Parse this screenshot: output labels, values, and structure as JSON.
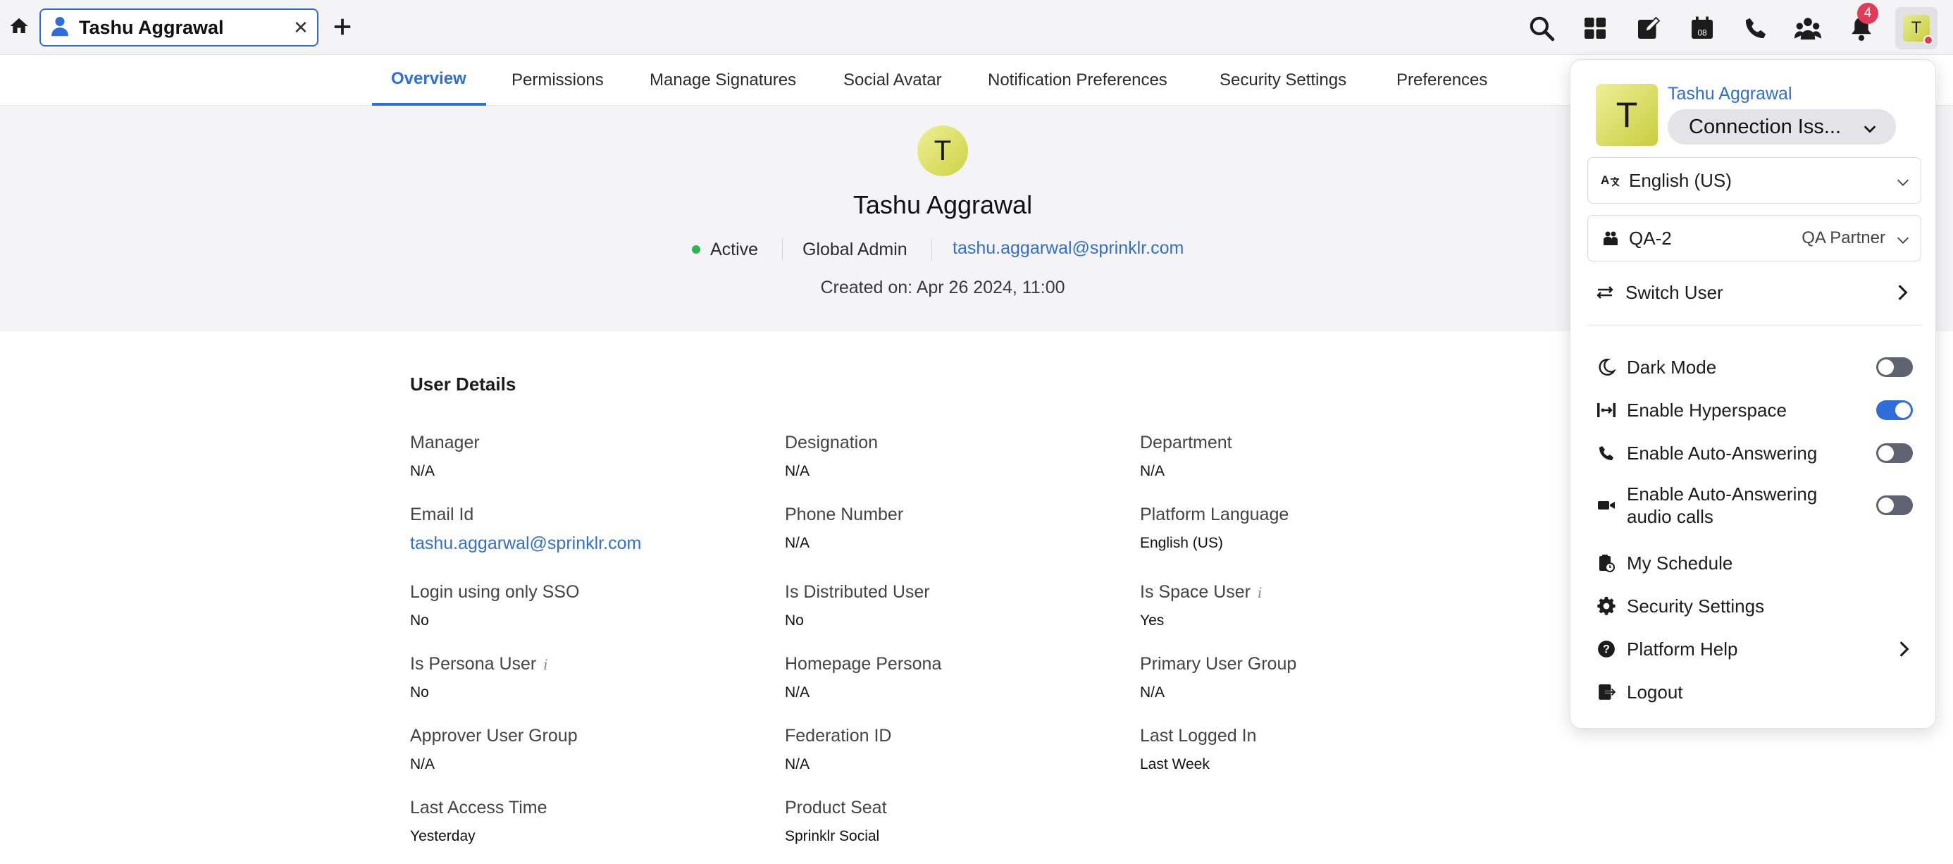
{
  "tabs": {
    "active_tab_label": "Tashu Aggrawal"
  },
  "notifications": {
    "count": "4"
  },
  "top_avatar": {
    "initial": "T"
  },
  "nav_tabs": [
    "Overview",
    "Permissions",
    "Manage Signatures",
    "Social Avatar",
    "Notification Preferences",
    "Security Settings",
    "Preferences"
  ],
  "profile": {
    "initial": "T",
    "name": "Tashu Aggrawal",
    "status": "Active",
    "role": "Global Admin",
    "email": "tashu.aggarwal@sprinklr.com",
    "created": "Created on: Apr 26 2024, 11:00"
  },
  "user_details": {
    "title": "User Details",
    "fields": [
      {
        "label": "Manager",
        "value": "N/A"
      },
      {
        "label": "Designation",
        "value": "N/A"
      },
      {
        "label": "Department",
        "value": "N/A"
      },
      {
        "label": "Email Id",
        "value": "tashu.aggarwal@sprinklr.com"
      },
      {
        "label": "Phone Number",
        "value": "N/A"
      },
      {
        "label": "Platform Language",
        "value": "English (US)"
      },
      {
        "label": "Login using only SSO",
        "value": "No"
      },
      {
        "label": "Is Distributed User",
        "value": "No"
      },
      {
        "label": "Is Space User",
        "value": "Yes"
      },
      {
        "label": "Is Persona User",
        "value": "No"
      },
      {
        "label": "Homepage Persona",
        "value": "N/A"
      },
      {
        "label": "Primary User Group",
        "value": "N/A"
      },
      {
        "label": "Approver User Group",
        "value": "N/A"
      },
      {
        "label": "Federation ID",
        "value": "N/A"
      },
      {
        "label": "Last Logged In",
        "value": "Last Week"
      },
      {
        "label": "Last Access Time",
        "value": "Yesterday"
      },
      {
        "label": "Product Seat",
        "value": "Sprinklr Social"
      }
    ],
    "info_glyph": "i"
  },
  "menu": {
    "initial": "T",
    "name": "Tashu Aggrawal",
    "status": "Connection Iss...",
    "language": "English (US)",
    "workspace": "QA-2",
    "workspace_role": "QA Partner",
    "switch_user": "Switch User",
    "dark_mode": "Dark Mode",
    "hyperspace": "Enable Hyperspace",
    "auto_answering": "Enable Auto-Answering",
    "auto_answering_audio_1": "Enable Auto-Answering",
    "auto_answering_audio_2": "audio calls",
    "my_schedule": "My Schedule",
    "security_settings": "Security Settings",
    "platform_help": "Platform Help",
    "logout": "Logout",
    "toggles": {
      "dark_mode": false,
      "hyperspace": true,
      "auto_answering": false,
      "auto_answering_audio": false
    }
  },
  "icons": [
    "home-icon",
    "user-icon",
    "close-icon",
    "plus-icon",
    "search-icon",
    "apps-grid-icon",
    "compose-icon",
    "calendar-icon",
    "phone-icon",
    "team-icon",
    "bell-icon"
  ],
  "colors": {
    "accent": "#2f6ed8",
    "badge": "#e23b57",
    "active_status": "#2fb44f"
  }
}
